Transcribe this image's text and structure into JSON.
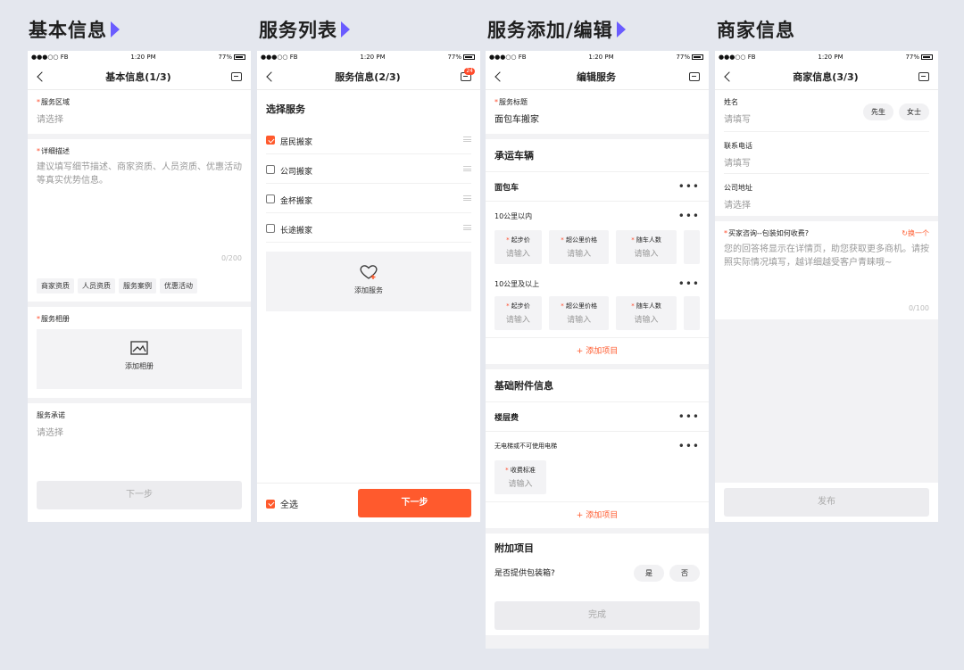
{
  "headings": [
    "基本信息",
    "服务列表",
    "服务添加/编辑",
    "商家信息"
  ],
  "status": {
    "carrier": "●●●○○ FB",
    "time": "1:20 PM",
    "battery": "77%"
  },
  "screen1": {
    "title": "基本信息(1/3)",
    "area_label": "服务区域",
    "area_placeholder": "请选择",
    "desc_label": "详细描述",
    "desc_placeholder": "建议填写细节描述、商家资质、人员资质、优惠活动等真实优势信息。",
    "desc_count": "0/200",
    "tags": [
      "商家资质",
      "人员资质",
      "服务案例",
      "优惠活动"
    ],
    "album_label": "服务相册",
    "add_album": "添加相册",
    "promise_label": "服务承诺",
    "promise_placeholder": "请选择",
    "next": "下一步"
  },
  "screen2": {
    "title": "服务信息(2/3)",
    "badge": "24",
    "select_title": "选择服务",
    "services": [
      {
        "name": "居民搬家",
        "checked": true
      },
      {
        "name": "公司搬家",
        "checked": false
      },
      {
        "name": "金杯搬家",
        "checked": false
      },
      {
        "name": "长途搬家",
        "checked": false
      }
    ],
    "add_service": "添加服务",
    "select_all": "全选",
    "next": "下一步"
  },
  "screen3": {
    "title": "编辑服务",
    "service_title_label": "服务标题",
    "service_title_value": "面包车搬家",
    "vehicle_title": "承运车辆",
    "vehicle": "面包车",
    "range1": "10公里以内",
    "range2": "10公里及以上",
    "price_fields": [
      "起步价",
      "超公里价格",
      "随车人数"
    ],
    "input_placeholder": "请输入",
    "add_item": "+ 添加项目",
    "extras_title": "基础附件信息",
    "floor_fee": "楼层费",
    "no_elevator": "无电梯或不可使用电梯",
    "fee_standard": "收费标准",
    "addon_title": "附加项目",
    "packing_q": "是否提供包装箱?",
    "yes": "是",
    "no": "否",
    "done": "完成"
  },
  "screen4": {
    "title": "商家信息(3/3)",
    "name_label": "姓名",
    "name_placeholder": "请填写",
    "gender_male": "先生",
    "gender_female": "女士",
    "phone_label": "联系电话",
    "phone_placeholder": "请填写",
    "address_label": "公司地址",
    "address_placeholder": "请选择",
    "faq_label": "买家咨询--包装如何收费?",
    "swap": "换一个",
    "faq_placeholder": "您的回答将显示在详情页，助您获取更多商机。请按照实际情况填写，越详细越受客户青睐哦~",
    "faq_count": "0/100",
    "publish": "发布"
  }
}
